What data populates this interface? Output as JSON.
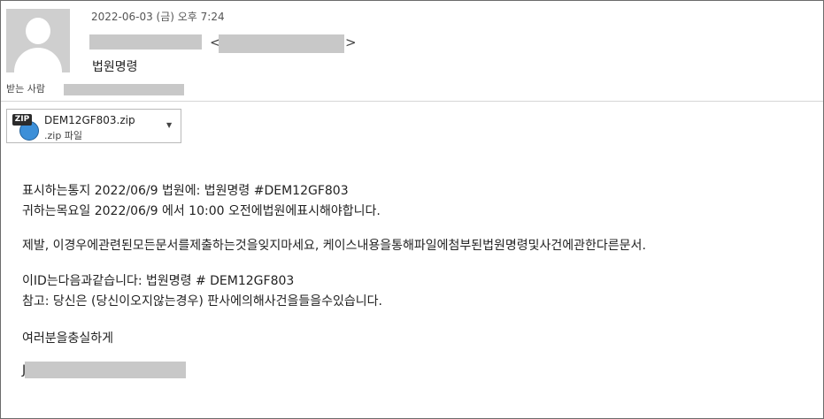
{
  "header": {
    "date": "2022-06-03 (금) 오후 7:24",
    "sender_open_bracket": "<",
    "sender_close_bracket": ">",
    "subject": "법원명령",
    "recipient_label": "받는 사람"
  },
  "attachment": {
    "icon_badge": "ZIP",
    "file_name": "DEM12GF803.zip",
    "file_type": ".zip 파일",
    "dropdown_icon": "chevron-down-icon"
  },
  "body": {
    "line1": "표시하는통지  2022/06/9 법원에: 법원명령 #DEM12GF803",
    "line2": "귀하는목요일  2022/06/9 에서 10:00 오전에법원에표시해야합니다.",
    "line3": "제발, 이경우에관련된모든문서를제출하는것을잊지마세요, 케이스내용을통해파일에첨부된법원명령및사건에관한다른문서.",
    "line4": "이ID는다음과같습니다: 법원명령 # DEM12GF803",
    "line5": "참고: 당신은 (당신이오지않는경우) 판사에의해사건을들을수있습니다.",
    "line6": "여러분을충실하게",
    "signature_initial": "J"
  }
}
